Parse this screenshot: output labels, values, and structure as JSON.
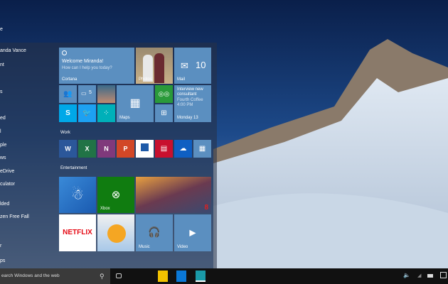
{
  "start_list": {
    "user": "anda Vance",
    "items": [
      "e",
      "nt",
      "s",
      "ed",
      "l",
      "ple",
      "ws",
      "eDrive",
      "culator",
      "lded",
      "zen Free Fall",
      "r",
      "ps"
    ]
  },
  "tiles": {
    "cortana": {
      "title": "Welcome Miranda!",
      "subtitle": "How can I help you today?",
      "label": "Cortana"
    },
    "photos": {
      "label": "Photos"
    },
    "mail": {
      "label": "Mail",
      "count": "10"
    },
    "messaging": {
      "count": "5"
    },
    "maps": {
      "label": "Maps"
    },
    "calendar": {
      "event": "Interview new consultant",
      "location": "Fourth Coffee",
      "time": "4:00 PM",
      "day": "Monday 13"
    },
    "xbox": {
      "label": "Xbox"
    },
    "netflix": {
      "label": "NETFLIX"
    },
    "music": {
      "label": "Music"
    },
    "video": {
      "label": "Video"
    }
  },
  "groups": {
    "work": "Work",
    "entertainment": "Entertainment"
  },
  "taskbar": {
    "search_placeholder": "earch Windows and the web"
  }
}
